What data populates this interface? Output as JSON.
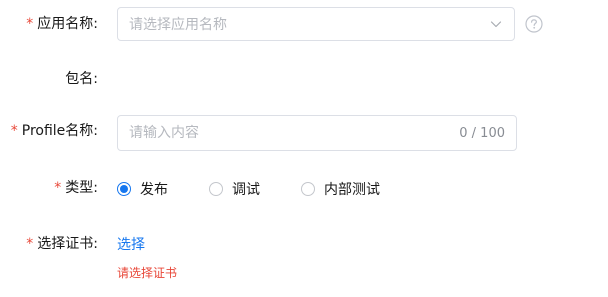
{
  "colors": {
    "required": "#e84738",
    "accent": "#1677ef",
    "error": "#e84738",
    "border": "#dcdfe6",
    "placeholder": "#b6b9bf"
  },
  "form": {
    "app_name": {
      "required_mark": "*",
      "label": "应用名称:",
      "placeholder": "请选择应用名称",
      "icon": "chevron-down-icon",
      "help_icon": "question-circle-icon"
    },
    "package_name": {
      "label": "包名:"
    },
    "profile_name": {
      "required_mark": "*",
      "label": "Profile名称:",
      "placeholder": "请输入内容",
      "value": "",
      "counter": "0 / 100"
    },
    "type": {
      "required_mark": "*",
      "label": "类型:",
      "options": [
        {
          "label": "发布",
          "checked": true
        },
        {
          "label": "调试",
          "checked": false
        },
        {
          "label": "内部测试",
          "checked": false
        }
      ]
    },
    "certificate": {
      "required_mark": "*",
      "label": "选择证书:",
      "link_text": "选择",
      "error_text": "请选择证书"
    }
  }
}
